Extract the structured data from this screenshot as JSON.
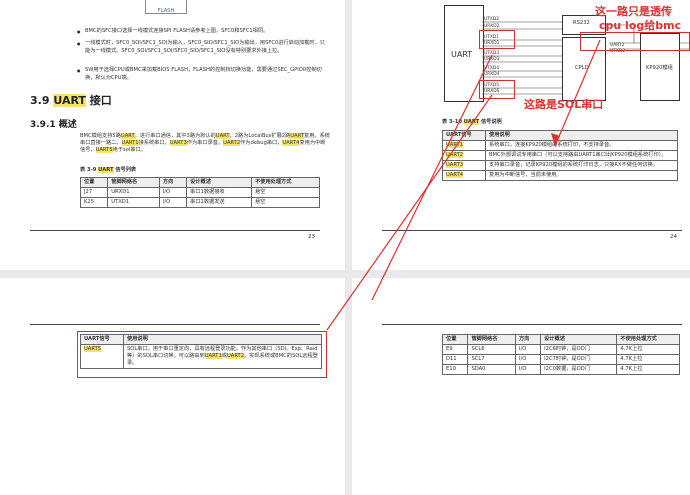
{
  "page23": {
    "flash_label": "FLASH",
    "bullets": [
      "BMC的SFC接口选择一线模式连接SPI FLASH请参考上图，SFC0和SFC1相同。",
      "一线模式时，SFC0_SOI/SFC1_SOI为输入，SFC0_SIO/SFC1_SIO为输出，用SFC0进行启动加载时，只能为一线模式。SFC0_SOI/SFC1_SOI/SFC0_SIO/SFC1_SIO没有特别要求外接上拉。",
      "SW用于选择CPU或BMC来加载BIOS FLASH，FLASH的控制权切换功能，需要通过SEC_GPIO0控制切换，默认为CPU端。"
    ],
    "section_num": "3.9",
    "section_hl": "UART",
    "section_rest": " 接口",
    "subsection": "3.9.1 概述",
    "intro_parts": [
      "BMC模组支持5路",
      "UART",
      "。进行串口通信，其中3路为默认的",
      "UART",
      "，2路为LocalBus扩展2路",
      "UART",
      "复用。系统串口直接一路二，",
      "UART1",
      "接系统串口，",
      "UART3",
      "作为串口录音。",
      "UART2",
      "作为debug串口，",
      "UART4",
      "复用为中断信号，",
      "UART5",
      "用于sol串口。"
    ],
    "table_caption_pre": "表 3-9 ",
    "table_caption_hl": "UART",
    "table_caption_post": " 信号列表",
    "table_headers": [
      "位置",
      "管脚网络名",
      "方向",
      "设计概述",
      "不使用处理方式"
    ],
    "table_rows": [
      [
        "J27",
        "URXD1",
        "I/O",
        "串口1数据接收",
        "悬空"
      ],
      [
        "K25",
        "UTXD1",
        "I/O",
        "串口1数据发送",
        "悬空"
      ]
    ],
    "page_number": "23"
  },
  "page24": {
    "diagram": {
      "uart_label": "UART",
      "rs232_label": "RS232",
      "cpld_label": "CPLD",
      "kp920_label": "KP920模组",
      "left_pins": [
        "UTXD2",
        "URXD2",
        "UTXD1",
        "URXD1",
        "UTXD3",
        "URXD3",
        "UTXD4",
        "URXD4",
        "UTXD5",
        "URXD5"
      ],
      "kp_pins": [
        "UART2",
        "UTXD2"
      ]
    },
    "annotation_top_line1": "这一路只是透传",
    "annotation_top_line2": "cpu log给bmc",
    "annotation_mid": "这路是SOL串口",
    "table_caption_pre": "表 3-10 ",
    "table_caption_hl": "UART",
    "table_caption_post": " 信号说明",
    "table_headers": [
      "UART信号",
      "使用说明"
    ],
    "table_rows": [
      [
        "UART1",
        "系统串口，连接KP920模组的系统打印，不支持录音。"
      ],
      [
        "UART2",
        "BMC外部调试专用串口（可以支持路由UART1串口出KP920模组系统打印）。"
      ],
      [
        "UART3",
        "支持串口录音，记录KP920模组的系统打印日志，只接RX不做任何切换。"
      ],
      [
        "UART4",
        "复用为中断信号，当前未使用。"
      ]
    ],
    "page_number": "24"
  },
  "page25": {
    "table_headers": [
      "UART信号",
      "使用说明"
    ],
    "row_signal": "UART5",
    "row_desc_parts": [
      "SOL串口。用于串口重定向，具有远程登录功能。作为其他串口（SDI、Exp、Raid等）的SOL串口切换，可以路由到",
      "UART1",
      "或",
      "UART2",
      "。实现系统或BMC的SOL远程登录。"
    ]
  },
  "page26": {
    "table_headers": [
      "位置",
      "管脚网络名",
      "方向",
      "设计概述",
      "不使用处理方式"
    ],
    "table_rows": [
      [
        "E9",
        "SCL6",
        "I/O",
        "I2C6时钟，是OD门",
        "4.7K上拉"
      ],
      [
        "D11",
        "SCL7",
        "I/O",
        "I2C7时钟，是OD门",
        "4.7K上拉"
      ],
      [
        "E10",
        "SDA0",
        "I/O",
        "I2C0数据，是OD门",
        "4.7K上拉"
      ]
    ]
  },
  "colors": {
    "highlight": "#f7e36a",
    "annotation_red": "#e03030"
  }
}
